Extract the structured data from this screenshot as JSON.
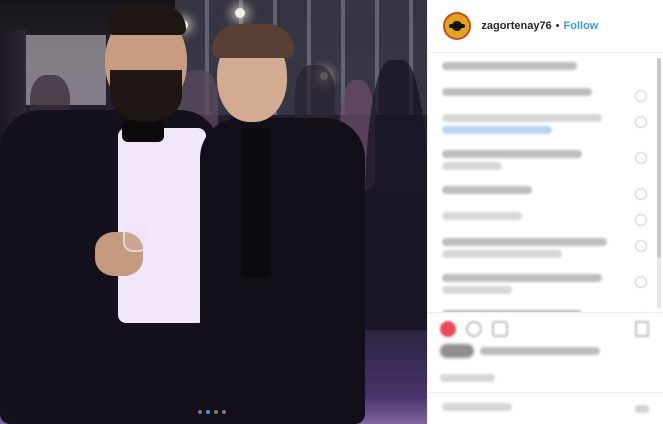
{
  "post": {
    "author": {
      "username": "zagortenay76",
      "separator": "•",
      "follow_label": "Follow"
    },
    "carousel": {
      "slide_count": 4,
      "active_index": 1
    },
    "comments_count_visible": 11
  },
  "icons": {
    "avatar": "profile-avatar-icon",
    "like": "heart-icon",
    "comment": "comment-bubble-icon",
    "share": "share-icon",
    "save": "bookmark-icon"
  },
  "colors": {
    "follow": "#3897f0",
    "like": "#ed4956",
    "text": "#262626"
  }
}
